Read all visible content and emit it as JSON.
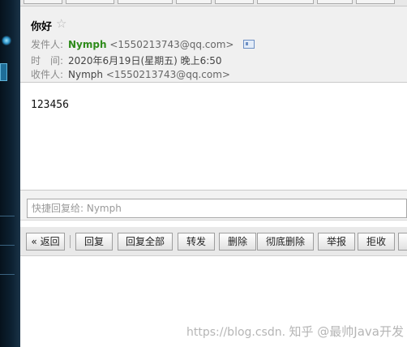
{
  "email": {
    "subject": "你好",
    "from_label": "发件人:",
    "from_name": "Nymph",
    "from_addr": "<1550213743@qq.com>",
    "time_label": "时　间:",
    "time_value": "2020年6月19日(星期五) 晚上6:50",
    "to_label": "收件人:",
    "to_name": "Nymph",
    "to_addr": "<1550213743@qq.com>",
    "body": "123456"
  },
  "quick_reply": {
    "placeholder": "快捷回复给: Nymph"
  },
  "toolbar": {
    "back": "« 返回",
    "reply": "回复",
    "reply_all": "回复全部",
    "forward": "转发",
    "delete": "删除",
    "delete_permanent": "彻底删除",
    "report": "举报",
    "reject": "拒收"
  },
  "watermark": {
    "url_text": "https://blog.csdn.",
    "zh_text": "知乎 @最帅Java开发"
  }
}
